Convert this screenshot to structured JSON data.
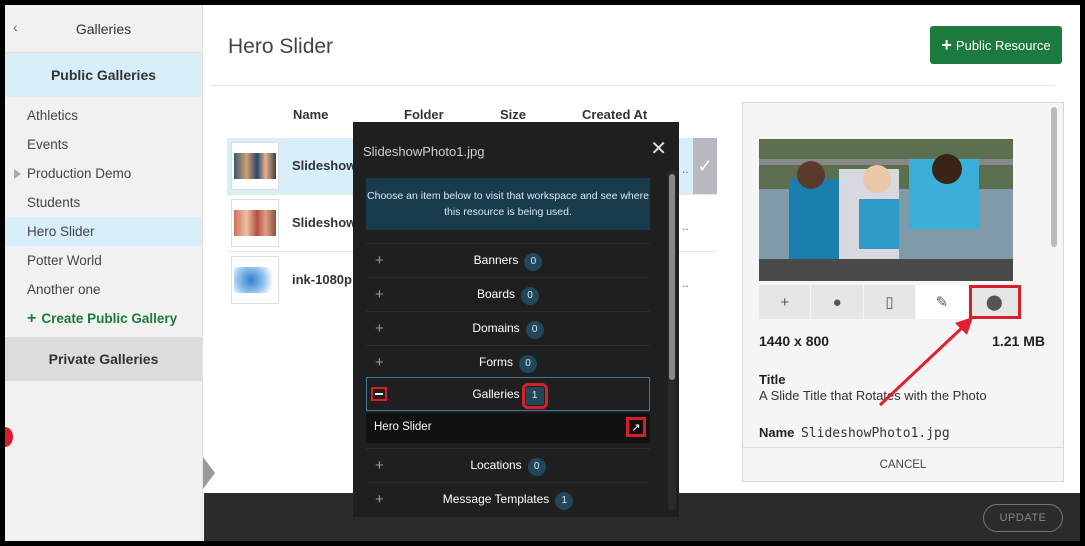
{
  "sidebar": {
    "back_icon": "chevron-left-icon",
    "header": "Galleries",
    "public_section": "Public Galleries",
    "items": [
      {
        "label": "Athletics"
      },
      {
        "label": "Events"
      },
      {
        "label": "Production Demo"
      },
      {
        "label": "Students"
      },
      {
        "label": "Hero Slider"
      },
      {
        "label": "Potter World"
      },
      {
        "label": "Another one"
      }
    ],
    "create_label": "Create Public Gallery",
    "private_section": "Private Galleries"
  },
  "header": {
    "title": "Hero Slider",
    "public_resource_label": "Public Resource"
  },
  "table": {
    "columns": [
      "Name",
      "Folder",
      "Size",
      "Created At"
    ],
    "rows": [
      {
        "name": "Slideshow",
        "trail": "..",
        "selected": true
      },
      {
        "name": "Slideshow",
        "trail": ".."
      },
      {
        "name": "ink-1080p",
        "trail": ".."
      }
    ]
  },
  "detail": {
    "dimensions": "1440 x 800",
    "file_size": "1.21 MB",
    "title_label": "Title",
    "title_value": "A Slide Title that Rotates with the Photo",
    "name_label": "Name",
    "name_value": "SlideshowPhoto1.jpg",
    "cancel_label": "CANCEL",
    "tools": [
      "plus-icon",
      "minus-circle-icon",
      "trash-icon",
      "pencil-icon",
      "location-pin-icon"
    ]
  },
  "footer": {
    "update_label": "UPDATE"
  },
  "modal": {
    "title": "SlideshowPhoto1.jpg",
    "info": "Choose an item below to visit that workspace and see where this resource is being used.",
    "rows": [
      {
        "label": "Banners",
        "count": "0"
      },
      {
        "label": "Boards",
        "count": "0"
      },
      {
        "label": "Domains",
        "count": "0"
      },
      {
        "label": "Forms",
        "count": "0"
      },
      {
        "label": "Galleries",
        "count": "1"
      },
      {
        "label": "Locations",
        "count": "0"
      },
      {
        "label": "Message Templates",
        "count": "1"
      }
    ],
    "expanded_item": "Hero Slider"
  },
  "colors": {
    "primary_green": "#1d7a3e",
    "highlight_red": "#d81e2a",
    "selected_blue": "#d8eef9"
  }
}
